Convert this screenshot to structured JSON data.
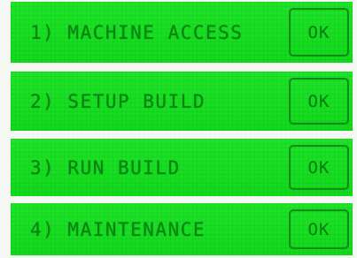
{
  "menu": [
    {
      "label": "1) MACHINE ACCESS",
      "button": "OK"
    },
    {
      "label": "2) SETUP BUILD",
      "button": "OK"
    },
    {
      "label": "3) RUN BUILD",
      "button": "OK"
    },
    {
      "label": "4) MAINTENANCE",
      "button": "OK"
    }
  ],
  "colors": {
    "lcd_background": "#12e21d",
    "lcd_text": "#0a7a12",
    "page_background": "#f4f7f2"
  }
}
